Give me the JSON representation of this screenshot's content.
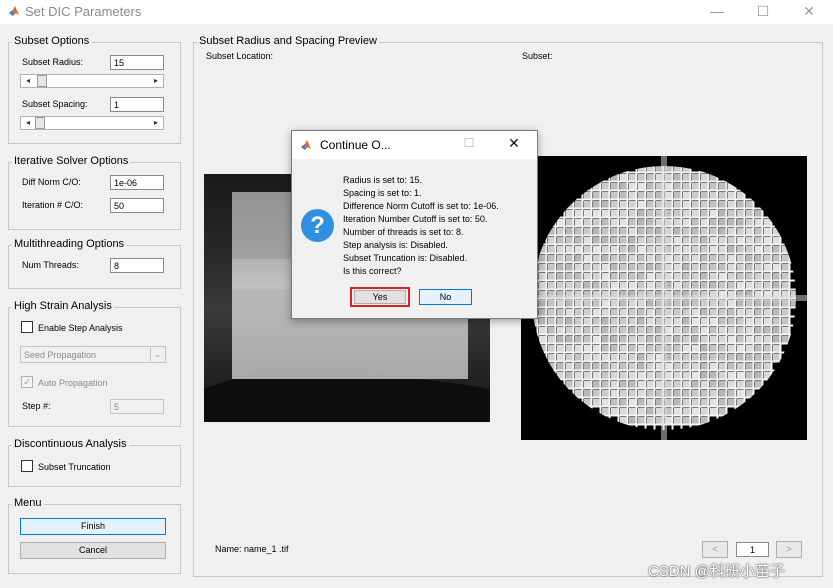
{
  "window": {
    "title": "Set DIC Parameters",
    "minimize_symbol": "—",
    "maximize_symbol": "☐",
    "close_symbol": "✕"
  },
  "subset_options": {
    "title": "Subset Options",
    "radius_label": "Subset Radius:",
    "radius_value": "15",
    "spacing_label": "Subset Spacing:",
    "spacing_value": "1"
  },
  "iterative_solver": {
    "title": "Iterative Solver Options",
    "diff_norm_label": "Diff Norm C/O:",
    "diff_norm_value": "1e-06",
    "iteration_label": "Iteration # C/O:",
    "iteration_value": "50"
  },
  "multithreading": {
    "title": "Multithreading Options",
    "num_threads_label": "Num Threads:",
    "num_threads_value": "8"
  },
  "high_strain": {
    "title": "High Strain Analysis",
    "enable_step_label": "Enable Step Analysis",
    "seed_propagation": "Seed Propagation",
    "auto_propagation_label": "Auto Propagation",
    "step_label": "Step #:",
    "step_value": "5"
  },
  "discontinuous": {
    "title": "Discontinuous Analysis",
    "subset_truncation_label": "Subset Truncation"
  },
  "menu": {
    "title": "Menu",
    "finish_label": "Finish",
    "cancel_label": "Cancel"
  },
  "preview": {
    "title": "Subset Radius and Spacing Preview",
    "location_label": "Subset Location:",
    "subset_label": "Subset:",
    "name_label": "Name: name_1 .tif",
    "prev_symbol": "<",
    "next_symbol": ">",
    "page_value": "1"
  },
  "dialog": {
    "title": "Continue O...",
    "maximize_symbol": "☐",
    "close_symbol": "✕",
    "question_symbol": "?",
    "lines": [
      "Radius is set to: 15.",
      "Spacing is set to: 1.",
      "Difference Norm Cutoff is set to: 1e-06.",
      "Iteration Number Cutoff is set to: 50.",
      "Number of threads is set to: 8.",
      "Step analysis is: Disabled.",
      "Subset Truncation is: Disabled.",
      "Is this correct?"
    ],
    "yes_label": "Yes",
    "no_label": "No"
  },
  "watermark": "CSDN @科研小苗子",
  "colors": {
    "window_bg": "#f0f0f0",
    "highlight_red": "#e02020",
    "question_blue": "#2f8fe0",
    "default_button_border": "#0078d7"
  }
}
